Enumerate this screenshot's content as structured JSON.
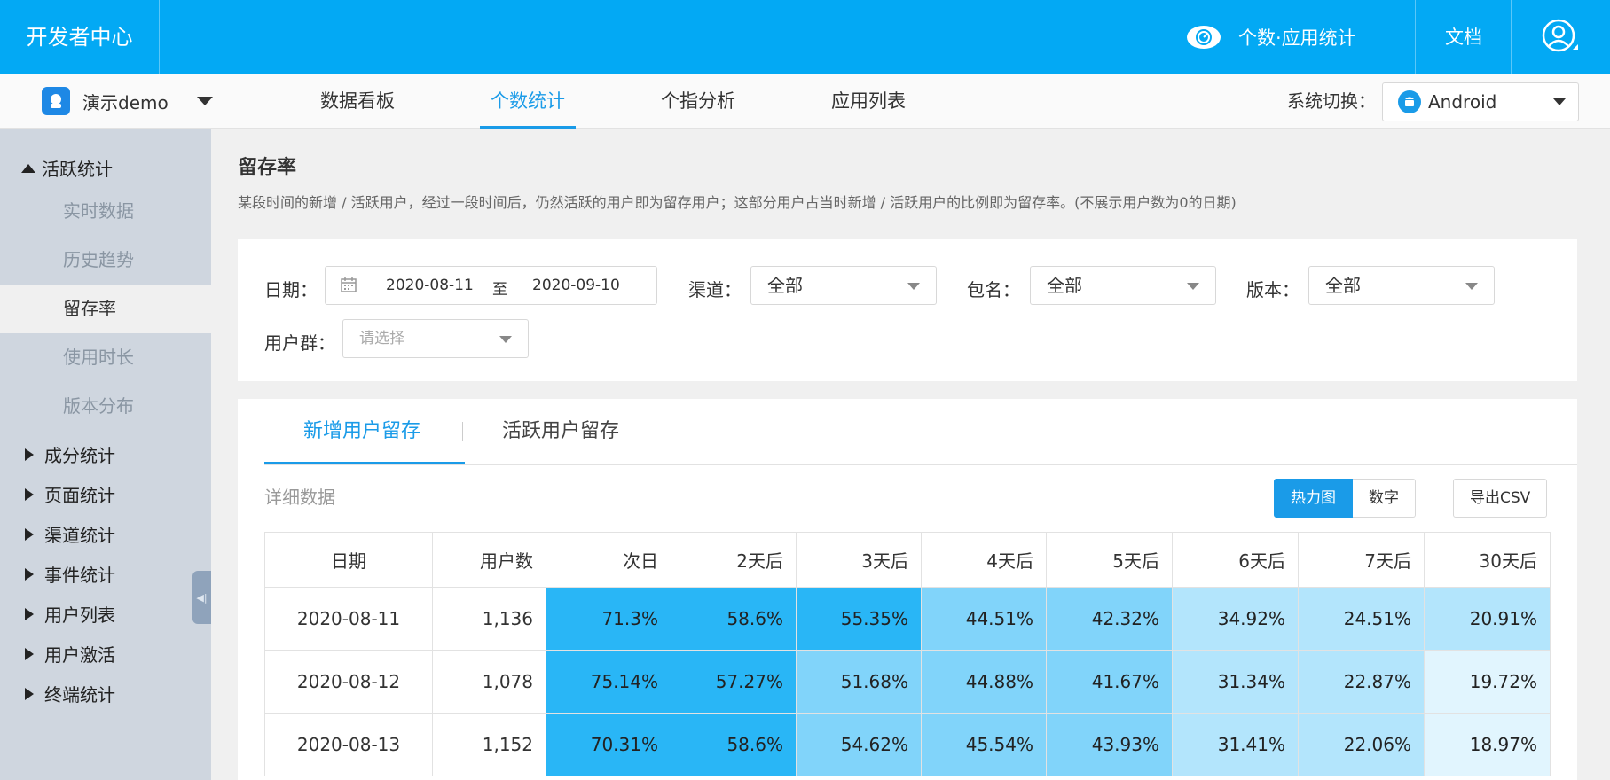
{
  "header": {
    "brand": "开发者中心",
    "stats_label": "个数·应用统计",
    "docs_label": "文档"
  },
  "nav": {
    "app_name": "演示demo",
    "tabs": [
      "数据看板",
      "个数统计",
      "个指分析",
      "应用列表"
    ],
    "active_tab": "个数统计",
    "system_label": "系统切换：",
    "system_value": "Android"
  },
  "sidebar": {
    "expanded_group": "活跃统计",
    "items": [
      "实时数据",
      "历史趋势",
      "留存率",
      "使用时长",
      "版本分布"
    ],
    "active_item": "留存率",
    "groups": [
      "成分统计",
      "页面统计",
      "渠道统计",
      "事件统计",
      "用户列表",
      "用户激活",
      "终端统计"
    ]
  },
  "page": {
    "title": "留存率",
    "description": "某段时间的新增 / 活跃用户，经过一段时间后，仍然活跃的用户即为留存用户；这部分用户占当时新增 / 活跃用户的比例即为留存率。(不展示用户数为0的日期)"
  },
  "filters": {
    "date_label": "日期：",
    "date_start": "2020-08-11",
    "date_sep": "至",
    "date_end": "2020-09-10",
    "channel_label": "渠道：",
    "channel_value": "全部",
    "package_label": "包名：",
    "package_value": "全部",
    "version_label": "版本：",
    "version_value": "全部",
    "usergroup_label": "用户群：",
    "usergroup_placeholder": "请选择"
  },
  "data_tabs": [
    "新增用户留存",
    "活跃用户留存"
  ],
  "active_data_tab": "新增用户留存",
  "detail_label": "详细数据",
  "view_buttons": [
    "热力图",
    "数字"
  ],
  "export_label": "导出CSV",
  "colors": {
    "accent": "#03a9f4",
    "heat_levels": [
      "#29b6f6",
      "#81d4fa",
      "#b3e5fc",
      "#e1f5fe"
    ]
  },
  "table": {
    "headers": [
      "日期",
      "用户数",
      "次日",
      "2天后",
      "3天后",
      "4天后",
      "5天后",
      "6天后",
      "7天后",
      "30天后"
    ],
    "rows": [
      {
        "date": "2020-08-11",
        "users": "1,136",
        "cells": [
          {
            "v": "71.3%",
            "lvl": 0
          },
          {
            "v": "58.6%",
            "lvl": 0
          },
          {
            "v": "55.35%",
            "lvl": 0
          },
          {
            "v": "44.51%",
            "lvl": 1
          },
          {
            "v": "42.32%",
            "lvl": 1
          },
          {
            "v": "34.92%",
            "lvl": 2
          },
          {
            "v": "24.51%",
            "lvl": 2
          },
          {
            "v": "20.91%",
            "lvl": 2
          }
        ]
      },
      {
        "date": "2020-08-12",
        "users": "1,078",
        "cells": [
          {
            "v": "75.14%",
            "lvl": 0
          },
          {
            "v": "57.27%",
            "lvl": 0
          },
          {
            "v": "51.68%",
            "lvl": 1
          },
          {
            "v": "44.88%",
            "lvl": 1
          },
          {
            "v": "41.67%",
            "lvl": 1
          },
          {
            "v": "31.34%",
            "lvl": 2
          },
          {
            "v": "22.87%",
            "lvl": 2
          },
          {
            "v": "19.72%",
            "lvl": 3
          }
        ]
      },
      {
        "date": "2020-08-13",
        "users": "1,152",
        "cells": [
          {
            "v": "70.31%",
            "lvl": 0
          },
          {
            "v": "58.6%",
            "lvl": 0
          },
          {
            "v": "54.62%",
            "lvl": 1
          },
          {
            "v": "45.54%",
            "lvl": 1
          },
          {
            "v": "43.93%",
            "lvl": 1
          },
          {
            "v": "31.41%",
            "lvl": 2
          },
          {
            "v": "22.06%",
            "lvl": 2
          },
          {
            "v": "18.97%",
            "lvl": 3
          }
        ]
      }
    ]
  }
}
